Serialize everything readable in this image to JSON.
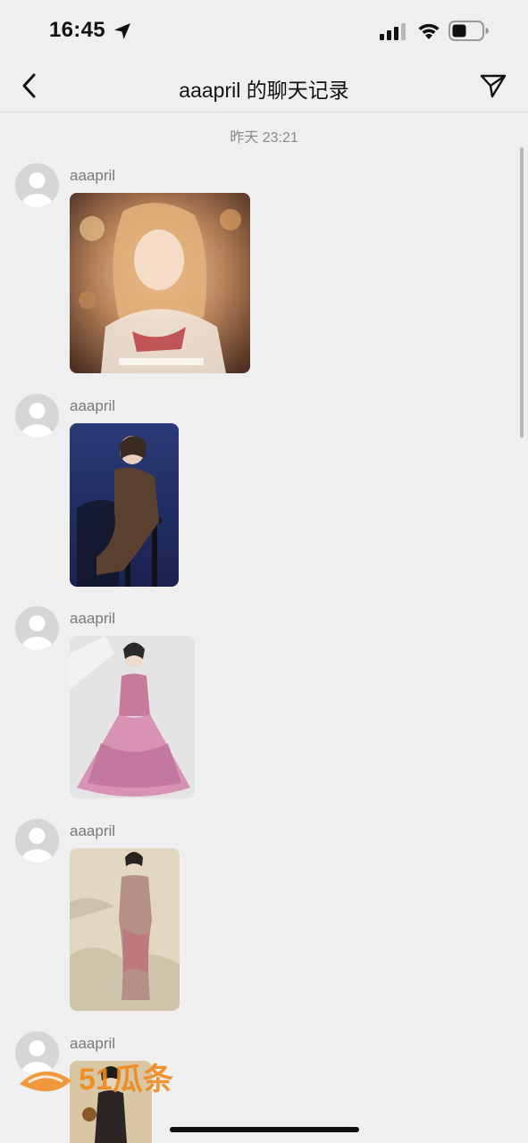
{
  "status_bar": {
    "time": "16:45",
    "icons": [
      "location-arrow-icon",
      "cellular-signal-icon",
      "wifi-icon",
      "battery-icon"
    ]
  },
  "nav": {
    "title": "aaapril 的聊天记录",
    "back_icon": "chevron-left-icon",
    "action_icon": "send-icon"
  },
  "timestamp": "昨天 23:21",
  "messages": [
    {
      "sender": "aaapril",
      "image": "anime girl mosaic artwork"
    },
    {
      "sender": "aaapril",
      "image": "woman in black dress seated on stool"
    },
    {
      "sender": "aaapril",
      "image": "woman in pink tulle gown"
    },
    {
      "sender": "aaapril",
      "image": "woman in qipao dress"
    },
    {
      "sender": "aaapril",
      "image": "woman in dark qipao"
    }
  ],
  "watermark": {
    "brand": "51瓜条"
  },
  "colors": {
    "background": "#efefef",
    "text_primary": "#111111",
    "text_secondary": "#7a7a7a",
    "watermark_orange": "#f08a1c"
  }
}
